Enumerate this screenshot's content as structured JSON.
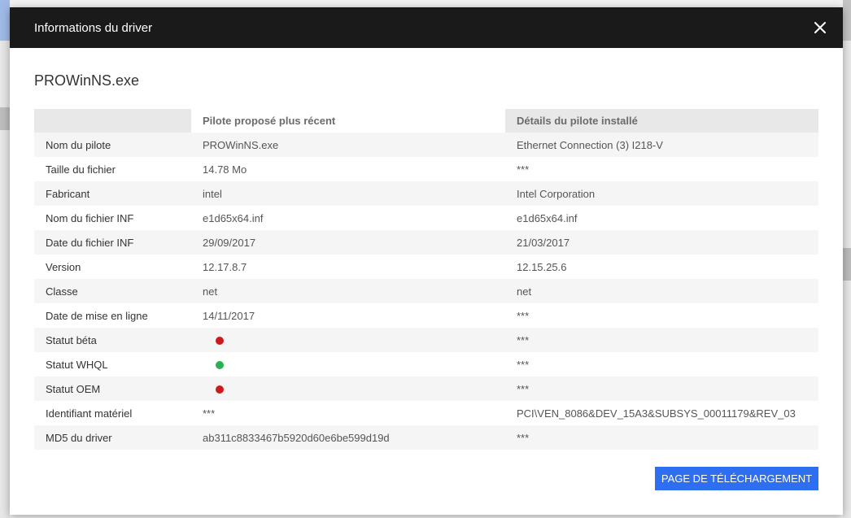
{
  "modal": {
    "title": "Informations du driver",
    "file_name": "PROWinNS.exe",
    "close_icon": "close-icon",
    "download_label": "PAGE DE TÉLÉCHARGEMENT",
    "accent_color": "#2e6ef0"
  },
  "table": {
    "headers": [
      "",
      "Pilote proposé plus récent",
      "Détails du pilote installé"
    ],
    "rows": [
      {
        "label": "Nom du pilote",
        "proposed": "PROWinNS.exe",
        "installed": "Ethernet Connection (3) I218-V"
      },
      {
        "label": "Taille du fichier",
        "proposed": "14.78 Mo",
        "installed": "***"
      },
      {
        "label": "Fabricant",
        "proposed": "intel",
        "installed": "Intel Corporation"
      },
      {
        "label": "Nom du fichier INF",
        "proposed": "e1d65x64.inf",
        "installed": "e1d65x64.inf"
      },
      {
        "label": "Date du fichier INF",
        "proposed": "29/09/2017",
        "installed": "21/03/2017"
      },
      {
        "label": "Version",
        "proposed": "12.17.8.7",
        "installed": "12.15.25.6"
      },
      {
        "label": "Classe",
        "proposed": "net",
        "installed": "net"
      },
      {
        "label": "Date de mise en ligne",
        "proposed": "14/11/2017",
        "installed": "***"
      },
      {
        "label": "Statut béta",
        "proposed_status": "#d0191c",
        "installed": "***"
      },
      {
        "label": "Statut WHQL",
        "proposed_status": "#29b14f",
        "installed": "***"
      },
      {
        "label": "Statut OEM",
        "proposed_status": "#d0191c",
        "installed": "***"
      },
      {
        "label": "Identifiant matériel",
        "proposed": "***",
        "installed": "PCI\\VEN_8086&DEV_15A3&SUBSYS_00011179&REV_03"
      },
      {
        "label": "MD5 du driver",
        "proposed": "ab311c8833467b5920d60e6be599d19d",
        "installed": "***"
      }
    ]
  }
}
